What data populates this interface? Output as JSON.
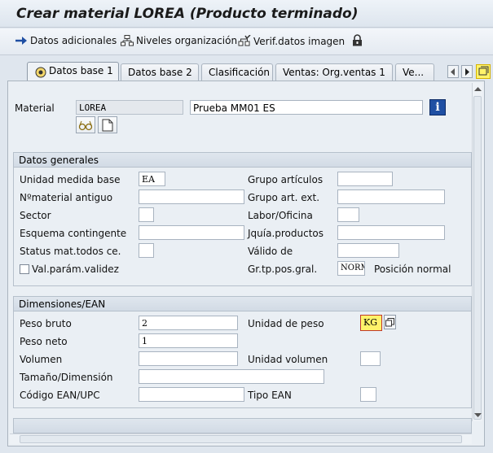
{
  "window": {
    "title": "Crear material LOREA (Producto terminado)"
  },
  "toolbar": {
    "datos_adicionales": "Datos adicionales",
    "niveles_organizacion": "Niveles organización",
    "verif_datos_imagen": "Verif.datos imagen"
  },
  "tabs": [
    {
      "label": "Datos base 1",
      "active": true
    },
    {
      "label": "Datos base 2",
      "active": false
    },
    {
      "label": "Clasificación",
      "active": false
    },
    {
      "label": "Ventas: Org.ventas 1",
      "active": false
    },
    {
      "label": "Ve...",
      "active": false
    }
  ],
  "material": {
    "label": "Material",
    "code": "LOREA",
    "description": "Prueba MM01 ES"
  },
  "datos_generales": {
    "title": "Datos generales",
    "unidad_medida_base": {
      "label": "Unidad medida base",
      "value": "EA"
    },
    "nmaterial_antiguo": {
      "label": "Nºmaterial antiguo",
      "value": ""
    },
    "sector": {
      "label": "Sector",
      "value": ""
    },
    "esquema_contingente": {
      "label": "Esquema contingente",
      "value": ""
    },
    "status_mat": {
      "label": "Status mat.todos ce.",
      "value": ""
    },
    "val_param_validez": {
      "label": "Val.parám.validez",
      "checked": false
    },
    "grupo_articulos": {
      "label": "Grupo artículos",
      "value": ""
    },
    "grupo_art_ext": {
      "label": "Grupo art. ext.",
      "value": ""
    },
    "labor_oficina": {
      "label": "Labor/Oficina",
      "value": ""
    },
    "jquia_productos": {
      "label": "Jquía.productos",
      "value": ""
    },
    "valido_de": {
      "label": "Válido de",
      "value": ""
    },
    "gr_tp_pos_gral": {
      "label": "Gr.tp.pos.gral.",
      "value": "NORM",
      "description": "Posición normal"
    }
  },
  "dimensiones": {
    "title": "Dimensiones/EAN",
    "peso_bruto": {
      "label": "Peso bruto",
      "value": "2"
    },
    "peso_neto": {
      "label": "Peso neto",
      "value": "1"
    },
    "volumen": {
      "label": "Volumen",
      "value": ""
    },
    "tamano": {
      "label": "Tamaño/Dimensión",
      "value": ""
    },
    "codigo_ean": {
      "label": "Código EAN/UPC",
      "value": ""
    },
    "unidad_peso": {
      "label": "Unidad de peso",
      "value": "KG"
    },
    "unidad_volumen": {
      "label": "Unidad volumen",
      "value": ""
    },
    "tipo_ean": {
      "label": "Tipo EAN",
      "value": ""
    }
  },
  "colors": {
    "accent": "#1f4fa3",
    "highlight": "#fff36a"
  }
}
